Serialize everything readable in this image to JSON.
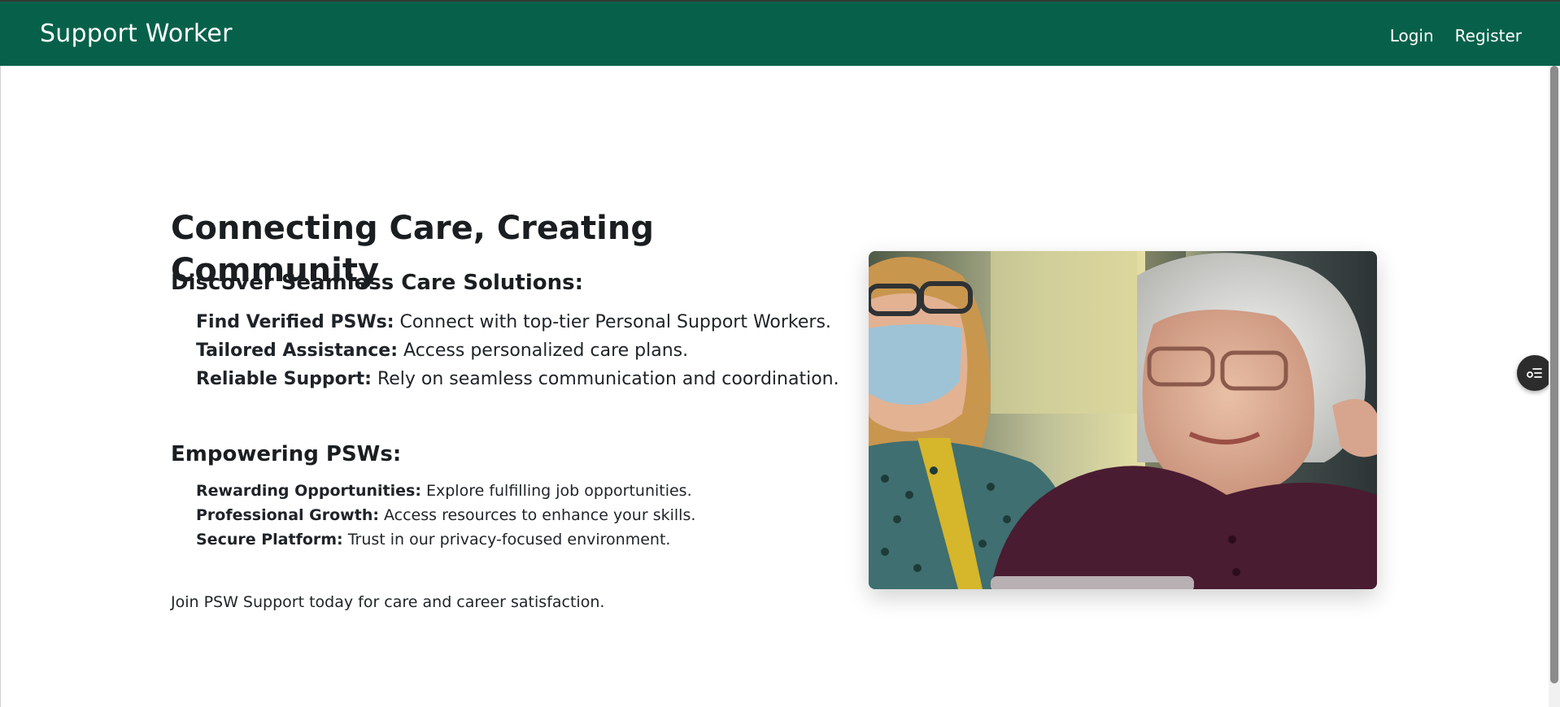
{
  "header": {
    "brand": "Support Worker",
    "nav": {
      "login": "Login",
      "register": "Register"
    }
  },
  "hero": {
    "title": "Connecting Care, Creating Community",
    "section1": {
      "heading": "Discover Seamless Care Solutions:",
      "items": [
        {
          "label": "Find Verified PSWs:",
          "text": " Connect with top-tier Personal Support Workers."
        },
        {
          "label": "Tailored Assistance:",
          "text": " Access personalized care plans."
        },
        {
          "label": "Reliable Support:",
          "text": " Rely on seamless communication and coordination."
        }
      ]
    },
    "section2": {
      "heading": "Empowering PSWs:",
      "items": [
        {
          "label": "Rewarding Opportunities:",
          "text": " Explore fulfilling job opportunities."
        },
        {
          "label": "Professional Growth:",
          "text": " Access resources to enhance your skills."
        },
        {
          "label": "Secure Platform:",
          "text": " Trust in our privacy-focused environment."
        }
      ]
    },
    "closing": "Join PSW Support today for care and career satisfaction."
  },
  "image": {
    "icon": "photo-caregiver-elderly-woman"
  },
  "floating_button": {
    "icon": "list-settings-icon"
  },
  "colors": {
    "header_bg": "#07614a",
    "header_text": "#ffffff",
    "body_text": "#1b1e21"
  }
}
